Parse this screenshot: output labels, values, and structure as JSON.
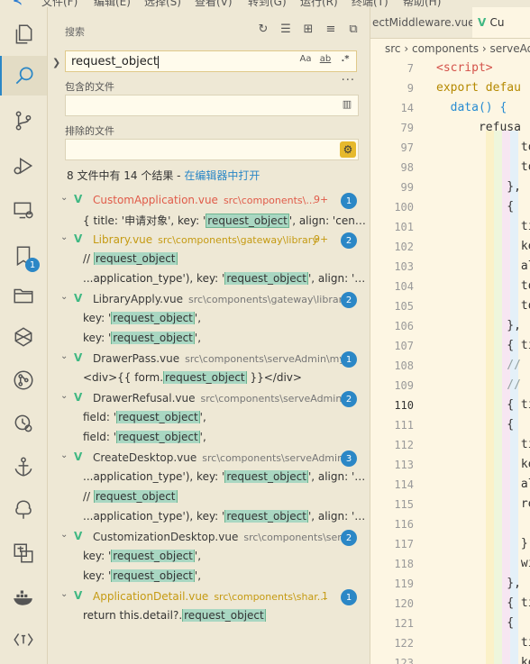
{
  "menubar": {
    "items": [
      "文件(F)",
      "编辑(E)",
      "选择(S)",
      "查看(V)",
      "转到(G)",
      "运行(R)",
      "终端(T)",
      "帮助(H)"
    ]
  },
  "sidebar": {
    "title": "搜索",
    "search_value": "request_object",
    "include_label": "包含的文件",
    "include_value": "",
    "exclude_label": "排除的文件",
    "exclude_value": "",
    "more_label": "···",
    "summary_text": "8 文件中有 14 个结果 - ",
    "summary_link": "在编辑器中打开",
    "match_case": "Aa",
    "whole_word": "ab",
    "regex": ".*"
  },
  "results": [
    {
      "file": "CustomApplication.vue",
      "path": "src\\components\\...",
      "count": "1",
      "extra": "9+",
      "color": "red",
      "matches": [
        {
          "pre": "{ title: '申请对象', key: '",
          "hl": "request_object",
          "post": "', align: 'center', ..."
        }
      ]
    },
    {
      "file": "Library.vue",
      "path": "src\\components\\gateway\\library",
      "count": "2",
      "extra": "9+",
      "color": "yellow",
      "matches": [
        {
          "pre": "// ",
          "hl": "request_object",
          "post": ""
        },
        {
          "pre": "...application_type'), key: '",
          "hl": "request_object",
          "post": "', align: 'cent..."
        }
      ]
    },
    {
      "file": "LibraryApply.vue",
      "path": "src\\components\\gateway\\library",
      "count": "2",
      "extra": "",
      "color": "",
      "matches": [
        {
          "pre": "key: '",
          "hl": "request_object",
          "post": "',"
        },
        {
          "pre": "key: '",
          "hl": "request_object",
          "post": "',"
        }
      ]
    },
    {
      "file": "DrawerPass.vue",
      "path": "src\\components\\serveAdmin\\my...",
      "count": "1",
      "extra": "",
      "color": "",
      "matches": [
        {
          "pre": "<div>{{ form.",
          "hl": "request_object",
          "post": " }}</div>"
        }
      ]
    },
    {
      "file": "DrawerRefusal.vue",
      "path": "src\\components\\serveAdmin\\...",
      "count": "2",
      "extra": "",
      "color": "",
      "matches": [
        {
          "pre": "field: '",
          "hl": "request_object",
          "post": "',"
        },
        {
          "pre": "field: '",
          "hl": "request_object",
          "post": "',"
        }
      ]
    },
    {
      "file": "CreateDesktop.vue",
      "path": "src\\components\\serveAdmin...",
      "count": "3",
      "extra": "",
      "color": "",
      "matches": [
        {
          "pre": "...application_type'), key: '",
          "hl": "request_object",
          "post": "', align: 'cent..."
        },
        {
          "pre": "// ",
          "hl": "request_object",
          "post": ""
        },
        {
          "pre": "...application_type'), key: '",
          "hl": "request_object",
          "post": "', align: 'cent..."
        }
      ]
    },
    {
      "file": "CustomizationDesktop.vue",
      "path": "src\\components\\ser...",
      "count": "2",
      "extra": "",
      "color": "",
      "matches": [
        {
          "pre": "key: '",
          "hl": "request_object",
          "post": "',"
        },
        {
          "pre": "key: '",
          "hl": "request_object",
          "post": "',"
        }
      ]
    },
    {
      "file": "ApplicationDetail.vue",
      "path": "src\\components\\shar...",
      "count": "1",
      "extra": "1",
      "color": "yellow",
      "matches": [
        {
          "pre": "return this.detail?.",
          "hl": "request_object",
          "post": ""
        }
      ]
    }
  ],
  "editor": {
    "tab1": "ectMiddleware.vue",
    "tab2": "Cu",
    "breadcrumb": [
      "src",
      "components",
      "serveAd"
    ],
    "lines": [
      {
        "n": "7",
        "t": "<script>"
      },
      {
        "n": "9",
        "t": "export defau"
      },
      {
        "n": "14",
        "t": "  data() {"
      },
      {
        "n": "79",
        "t": "      refusa"
      },
      {
        "n": "97",
        "t": "            to"
      },
      {
        "n": "98",
        "t": "            to"
      },
      {
        "n": "99",
        "t": "          },"
      },
      {
        "n": "100",
        "t": "          {"
      },
      {
        "n": "101",
        "t": "            ti"
      },
      {
        "n": "102",
        "t": "            ke"
      },
      {
        "n": "103",
        "t": "            al"
      },
      {
        "n": "104",
        "t": "            to"
      },
      {
        "n": "105",
        "t": "            to"
      },
      {
        "n": "106",
        "t": "          },"
      },
      {
        "n": "107",
        "t": "          { ti"
      },
      {
        "n": "108",
        "t": "          // r"
      },
      {
        "n": "109",
        "t": "          //"
      },
      {
        "n": "110",
        "t": "          { ti"
      },
      {
        "n": "111",
        "t": "          {"
      },
      {
        "n": "112",
        "t": "            ti"
      },
      {
        "n": "113",
        "t": "            ke"
      },
      {
        "n": "114",
        "t": "            al"
      },
      {
        "n": "115",
        "t": "            re"
      },
      {
        "n": "116",
        "t": ""
      },
      {
        "n": "117",
        "t": "            },"
      },
      {
        "n": "118",
        "t": "            wi"
      },
      {
        "n": "119",
        "t": "          },"
      },
      {
        "n": "120",
        "t": "          { ti"
      },
      {
        "n": "121",
        "t": "          {"
      },
      {
        "n": "122",
        "t": "            ti"
      },
      {
        "n": "123",
        "t": "            ke"
      },
      {
        "n": "124",
        "t": "            al"
      }
    ],
    "current_line": "110"
  },
  "activity_badge": "1"
}
